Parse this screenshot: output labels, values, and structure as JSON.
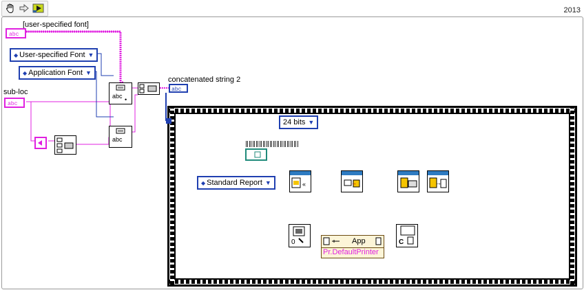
{
  "toolbar": {
    "tools": [
      {
        "icon": "hand-icon"
      },
      {
        "icon": "arrow-icon"
      },
      {
        "icon": "run-icon"
      }
    ],
    "year": "2013"
  },
  "labels": {
    "user_specified_font_label": "[user-specified font]",
    "sub_loc": "sub-loc",
    "concatenated_string": "concatenated string 2"
  },
  "rings": {
    "user_font": "User-specified Font",
    "app_font": "Application Font",
    "standard_report": "Standard Report",
    "bits": "24 bits"
  },
  "nodes": {
    "app_label": "App",
    "property": "Pr.DefaultPrinter"
  },
  "colors": {
    "string_wire": "#e020e0",
    "enum_wire": "#1f3fb0",
    "refnum_wire": "#1f8a7a",
    "error_wire": "#c8a020"
  }
}
